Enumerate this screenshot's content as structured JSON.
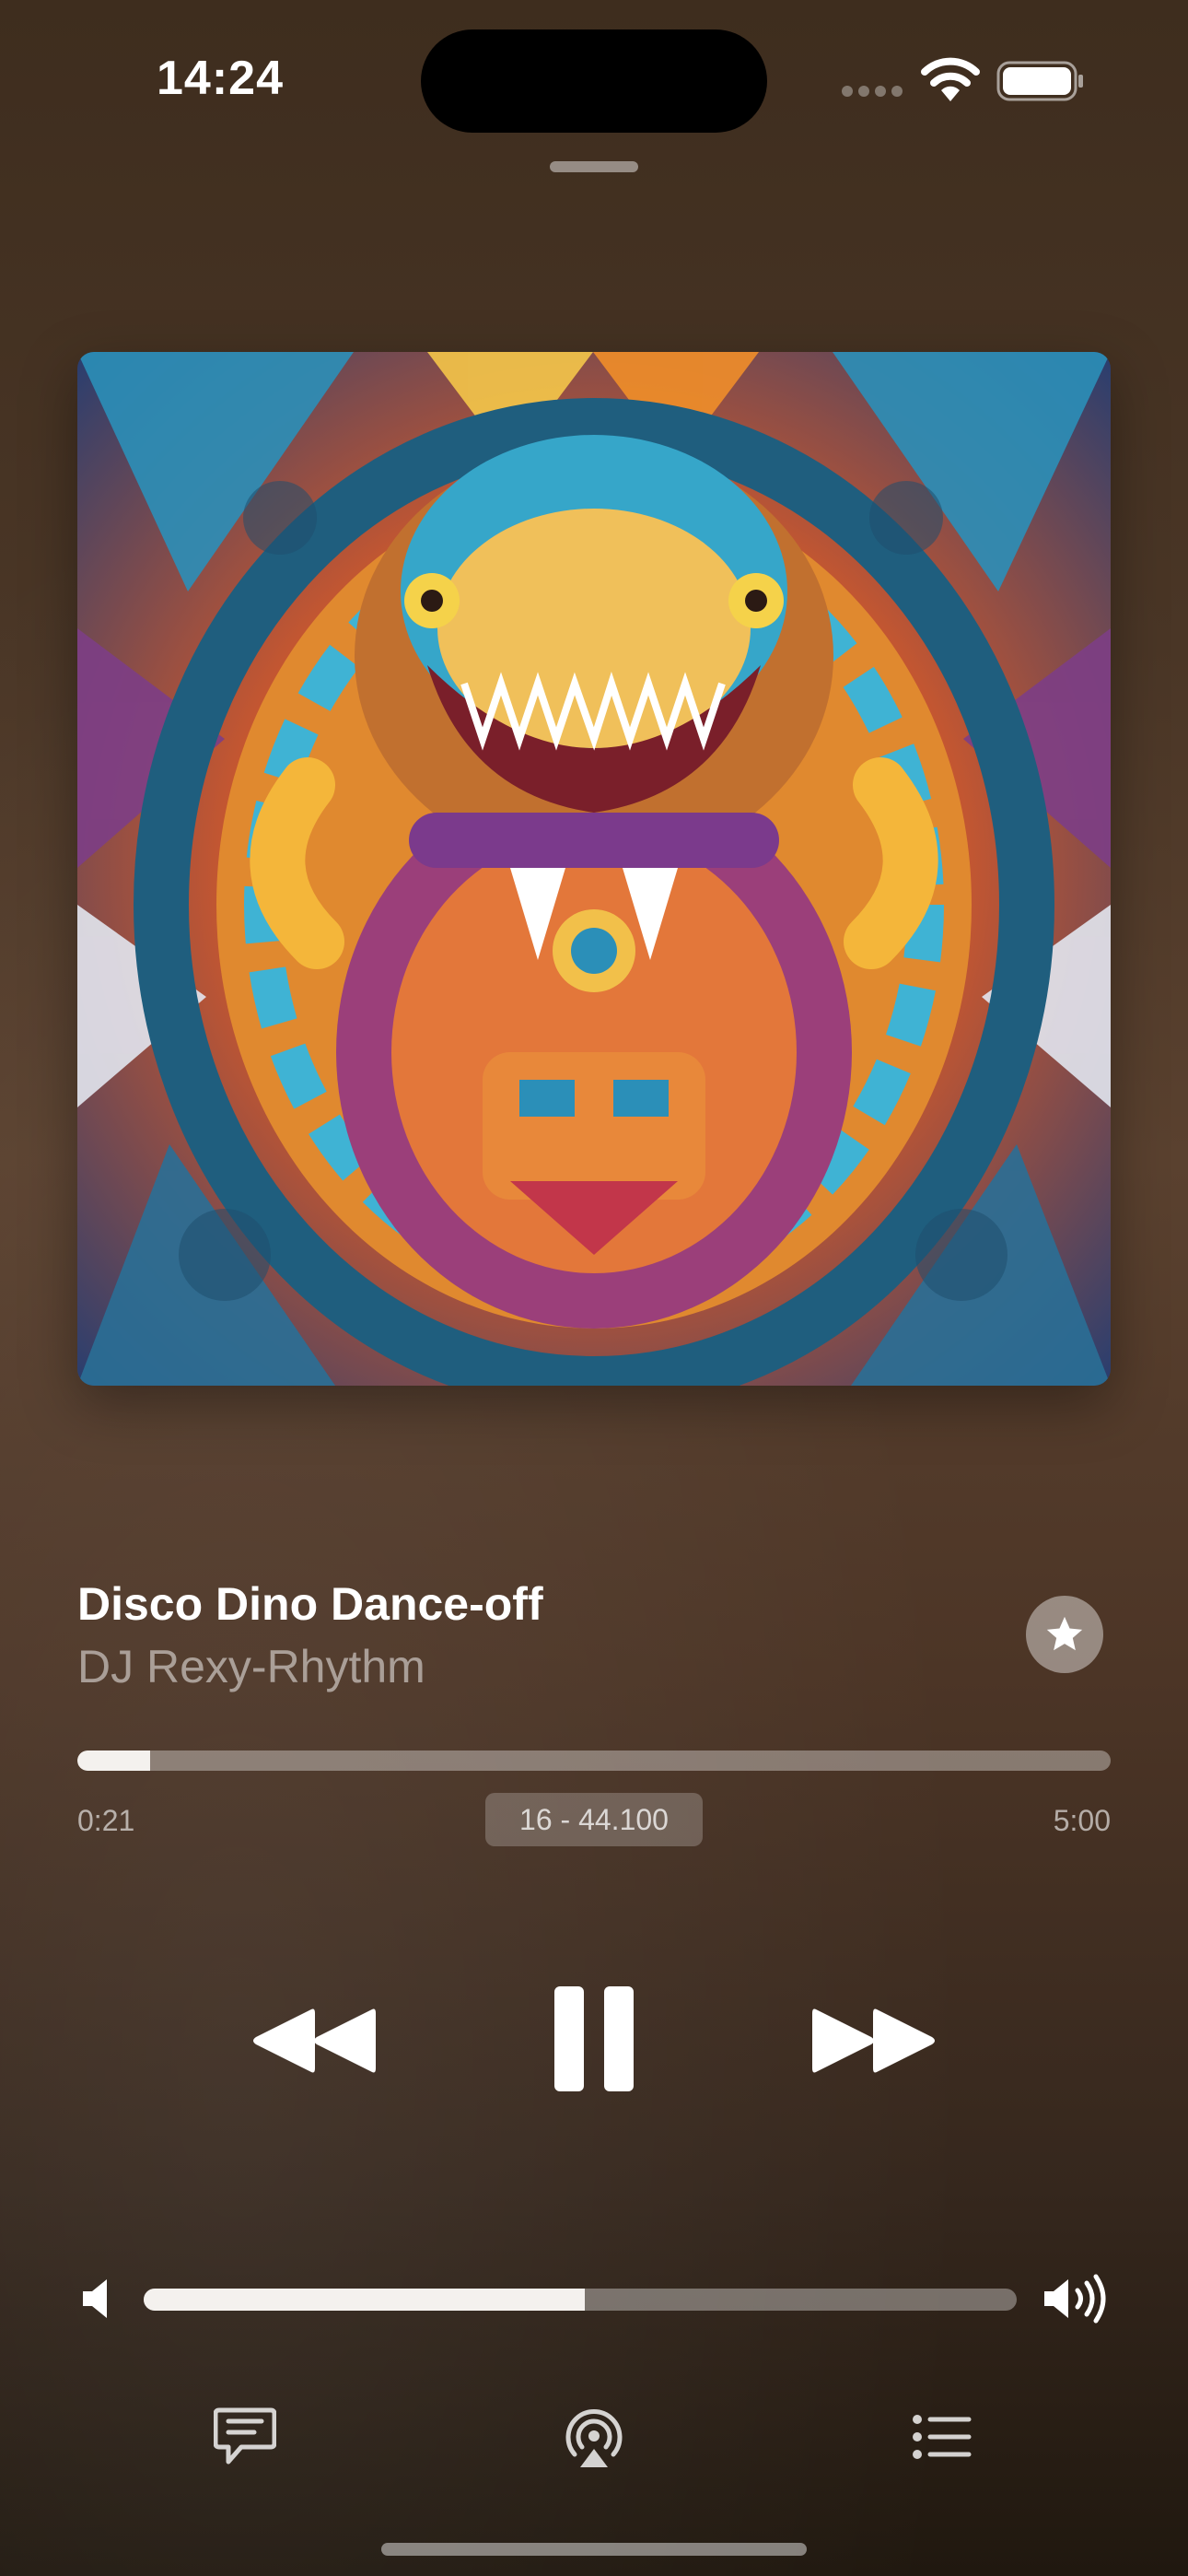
{
  "status_bar": {
    "time": "14:24",
    "wifi_icon": "wifi-icon",
    "battery_icon": "battery-icon"
  },
  "now_playing": {
    "title": "Disco Dino Dance-off",
    "artist": "DJ Rexy-Rhythm",
    "artwork": "album-artwork",
    "favorite_icon": "star-icon"
  },
  "playback": {
    "elapsed": "0:21",
    "total": "5:00",
    "progress_fraction": 0.07,
    "quality_badge": "16 - 44.100"
  },
  "controls": {
    "rewind_icon": "rewind-icon",
    "pause_icon": "pause-icon",
    "forward_icon": "fast-forward-icon"
  },
  "volume": {
    "level_fraction": 0.505,
    "low_icon": "speaker-low-icon",
    "high_icon": "speaker-high-icon"
  },
  "bottom_bar": {
    "lyrics_icon": "lyrics-icon",
    "airplay_icon": "airplay-icon",
    "queue_icon": "queue-icon"
  },
  "colors": {
    "accent": "#ffffff",
    "background_top": "#3e2d1e",
    "background_mid": "#5a412f",
    "background_bottom": "#20180f"
  }
}
